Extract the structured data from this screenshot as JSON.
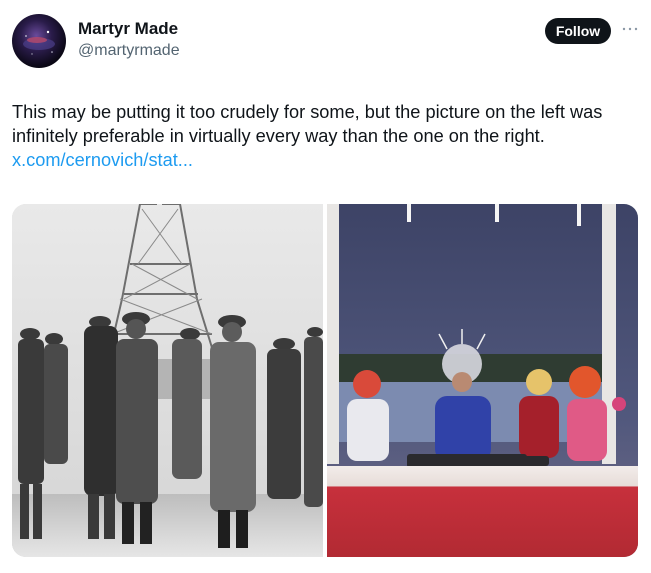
{
  "author": {
    "display_name": "Martyr Made",
    "handle": "@martyrmade",
    "avatar_icon": "avatar-image"
  },
  "actions": {
    "follow_label": "Follow",
    "more_icon": "more-horizontal-icon"
  },
  "tweet": {
    "text": "This may be putting it too crudely for some, but the picture on the left was infinitely preferable in virtually every way than the one on the right.",
    "link_text": "x.com/cernovich/stat..."
  },
  "media": {
    "images": [
      {
        "name": "left-photo",
        "kind": "black-and-white photograph"
      },
      {
        "name": "right-photo",
        "kind": "color photograph"
      }
    ]
  },
  "colors": {
    "text_primary": "#0f1419",
    "text_secondary": "#536471",
    "link": "#1d9bf0",
    "follow_bg": "#0f1419",
    "follow_text": "#ffffff"
  }
}
